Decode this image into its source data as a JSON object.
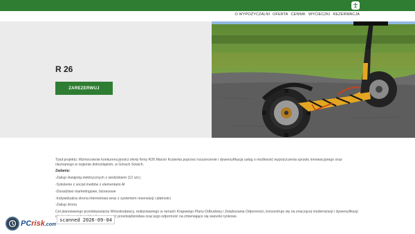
{
  "nav": {
    "items": [
      "O WYPOŻYCZALNI",
      "OFERTA",
      "CENNIK",
      "WYCIECZKI",
      "REZERWACJA"
    ]
  },
  "accessibility": {
    "icon": "accessibility-icon"
  },
  "hero": {
    "title": "R 26",
    "button_label": "ZAREZERWUJ"
  },
  "content": {
    "project_title": "Tytuł projektu: Wzmocnienie konkurencyjności oferty firmy R26 Marcin Kusterka poprzez rozszerzenie i dywersyfikację usług o możliwość wypożyczenia sprzętu innowacyjnego oraz nieznanego w regionie dolnośląskim, w Górach Sowich.",
    "tasks_label": "Zadania:",
    "tasks": [
      "-Zakup Hulajnóg elektrycznych z siedziskiem (12 szt.)",
      "-Szkolenie z social mediów z elementami AI",
      "-Doradztwo marketingowe, biznesowe",
      "-Indywidualna strona internetowa wraz z systemem rezerwacji i płatności",
      "-Zakup drona"
    ],
    "goal": "Cel planowanego przedsięwzięcia Wnioskodawcy, realizowanego w ramach Krajowego Planu Odbudowy i Zwiększania Odporności, koncentruje się na znaczącej modernizacji i dywersyfikacji oferty, aby zwiększyć konkurencyjność przedsiębiorstwa oraz jego odporność na zmieniające się warunki rynkowe."
  },
  "watermark": {
    "brand_pc": "PC",
    "brand_risk": "risk",
    "brand_com": ".com"
  },
  "scanned_stamp": "scanned 2026-09-04",
  "colors": {
    "accent": "#2e7d32",
    "hero_bg": "#ebebeb"
  }
}
